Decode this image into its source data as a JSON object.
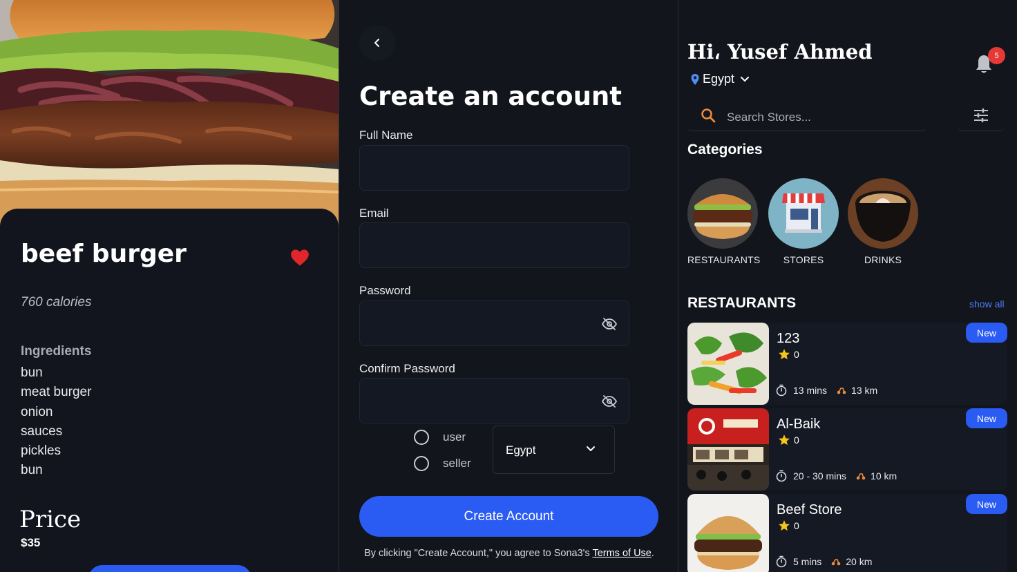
{
  "product": {
    "title": "beef burger",
    "calories": "760 calories",
    "ingredients_title": "Ingredients",
    "ingredients": [
      "bun",
      "meat burger",
      "onion",
      "sauces",
      "pickles",
      "bun"
    ],
    "price_label": "Price",
    "price": "$35",
    "favorited": true
  },
  "signup": {
    "title": "Create an account",
    "fields": {
      "full_name_label": "Full Name",
      "full_name_value": "",
      "email_label": "Email",
      "email_value": "",
      "password_label": "Password",
      "password_value": "",
      "confirm_label": "Confirm Password",
      "confirm_value": ""
    },
    "roles": [
      "user",
      "seller"
    ],
    "country": "Egypt",
    "create_button": "Create Account",
    "terms_prefix": "By clicking \"Create Account,\" you agree to Sona3's ",
    "terms_link": "Terms of Use",
    "terms_suffix": "."
  },
  "home": {
    "greeting": "Hi، Yusef Ahmed",
    "location": "Egypt",
    "notifications": "5",
    "search_placeholder": "Search Stores...",
    "categories_title": "Categories",
    "categories": [
      {
        "label": "RESTAURANTS",
        "icon": "burger-image"
      },
      {
        "label": "STORES",
        "icon": "storefront-icon"
      },
      {
        "label": "DRINKS",
        "icon": "coffee-image"
      }
    ],
    "restaurants_title": "RESTAURANTS",
    "show_all": "show all",
    "restaurants": [
      {
        "name": "123",
        "rating": "0",
        "time": "13 mins",
        "distance": "13 km",
        "badge": "New"
      },
      {
        "name": "Al-Baik",
        "rating": "0",
        "time": "20 - 30 mins",
        "distance": "10 km",
        "badge": "New"
      },
      {
        "name": "Beef Store",
        "rating": "0",
        "time": "5 mins",
        "distance": "20 km",
        "badge": "New"
      }
    ]
  },
  "colors": {
    "accent": "#2a5bf3",
    "background": "#12151c",
    "heart": "#e0262a",
    "badge": "#e53935",
    "link": "#4d7cf5",
    "search_icon": "#f08a3c"
  }
}
